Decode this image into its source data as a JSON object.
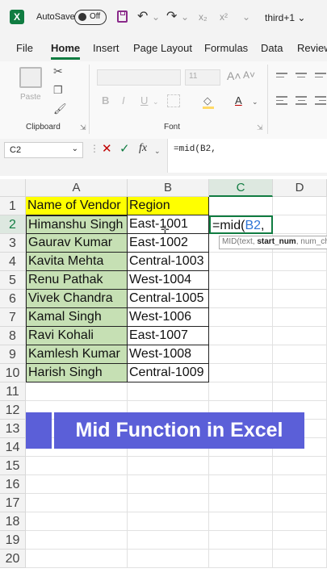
{
  "titlebar": {
    "logo": "X",
    "autosave_label": "AutoSave",
    "autosave_state": "Off",
    "filename": "third+1",
    "icons": [
      "save-icon",
      "undo-icon",
      "redo-icon",
      "subscript-icon",
      "superscript-icon",
      "chevron-down-icon"
    ]
  },
  "tabs": [
    "File",
    "Home",
    "Insert",
    "Page Layout",
    "Formulas",
    "Data",
    "Review"
  ],
  "ribbon": {
    "paste_label": "Paste",
    "clipboard_label": "Clipboard",
    "font_label": "Font",
    "font_size": "11"
  },
  "formula_bar": {
    "name_box": "C2",
    "fx": "fx",
    "formula": "=mid(B2,"
  },
  "grid": {
    "columns": [
      "A",
      "B",
      "C",
      "D"
    ],
    "rows": [
      "1",
      "2",
      "3",
      "4",
      "5",
      "6",
      "7",
      "8",
      "9",
      "10",
      "11",
      "12",
      "13",
      "14",
      "15",
      "16",
      "17",
      "18",
      "19",
      "20"
    ],
    "headers": {
      "a": "Name of Vendor",
      "b": "Region"
    },
    "data": [
      {
        "name": "Himanshu Singh",
        "region": "East-1001"
      },
      {
        "name": "Gaurav Kumar",
        "region": "East-1002"
      },
      {
        "name": "Kavita Mehta",
        "region": "Central-1003"
      },
      {
        "name": "Renu Pathak",
        "region": "West-1004"
      },
      {
        "name": "Vivek Chandra",
        "region": "Central-1005"
      },
      {
        "name": "Kamal Singh",
        "region": "West-1006"
      },
      {
        "name": "Ravi Kohali",
        "region": "East-1007"
      },
      {
        "name": "Kamlesh Kumar",
        "region": "West-1008"
      },
      {
        "name": "Harish Singh",
        "region": "Central-1009"
      }
    ],
    "active_cell": {
      "prefix": "=mid(",
      "ref": "B2",
      "suffix": ","
    },
    "tooltip": {
      "fn": "MID(text, ",
      "bold_arg": "start_num",
      "rest": ", num_chars)"
    }
  },
  "banner": "Mid Function in Excel",
  "colors": {
    "excel_green": "#107c41",
    "header_yellow": "#ffff00",
    "name_green": "#c6e0b4",
    "banner": "#5b5fd8"
  }
}
